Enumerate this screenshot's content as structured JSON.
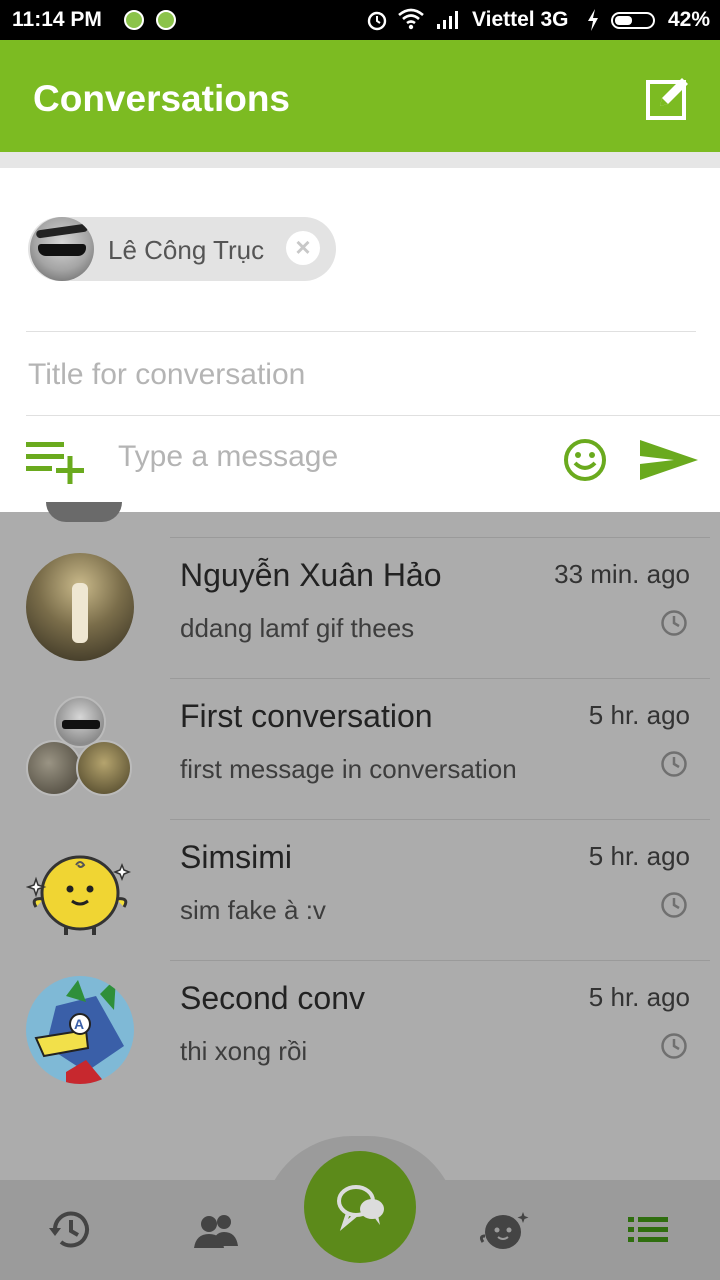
{
  "status_bar": {
    "time": "11:14 PM",
    "carrier": "Viettel 3G",
    "battery": "42%"
  },
  "app_bar": {
    "title": "Conversations",
    "compose_icon": "compose-icon"
  },
  "new_conversation": {
    "recipient_chip": {
      "name": "Lê Công Trục",
      "remove_icon": "close-icon"
    },
    "title_placeholder": "Title for conversation",
    "message_placeholder": "Type a message",
    "icons": {
      "attach": "playlist-add-icon",
      "emoji": "emoji-icon",
      "send": "send-icon"
    }
  },
  "conversations": [
    {
      "name": "Nguyễn Xuân Hảo",
      "last_message": "ddang lamf gif thees",
      "time": "33 min. ago"
    },
    {
      "name": "First conversation",
      "last_message": "first message in conversation",
      "time": "5 hr. ago"
    },
    {
      "name": "Simsimi",
      "last_message": "sim fake à :v",
      "time": "5 hr. ago"
    },
    {
      "name": "Second conv",
      "last_message": "thi xong rồi",
      "time": "5 hr. ago"
    }
  ],
  "bottom_nav": {
    "items": [
      "history-icon",
      "contacts-icon",
      "chat-bubbles-icon",
      "simsimi-icon",
      "list-icon"
    ],
    "active": "list-icon"
  },
  "colors": {
    "primary": "#7cbb22",
    "accent": "#6aaa1e",
    "overlay_background": "#acacac",
    "fab": "#5c8a1a"
  }
}
